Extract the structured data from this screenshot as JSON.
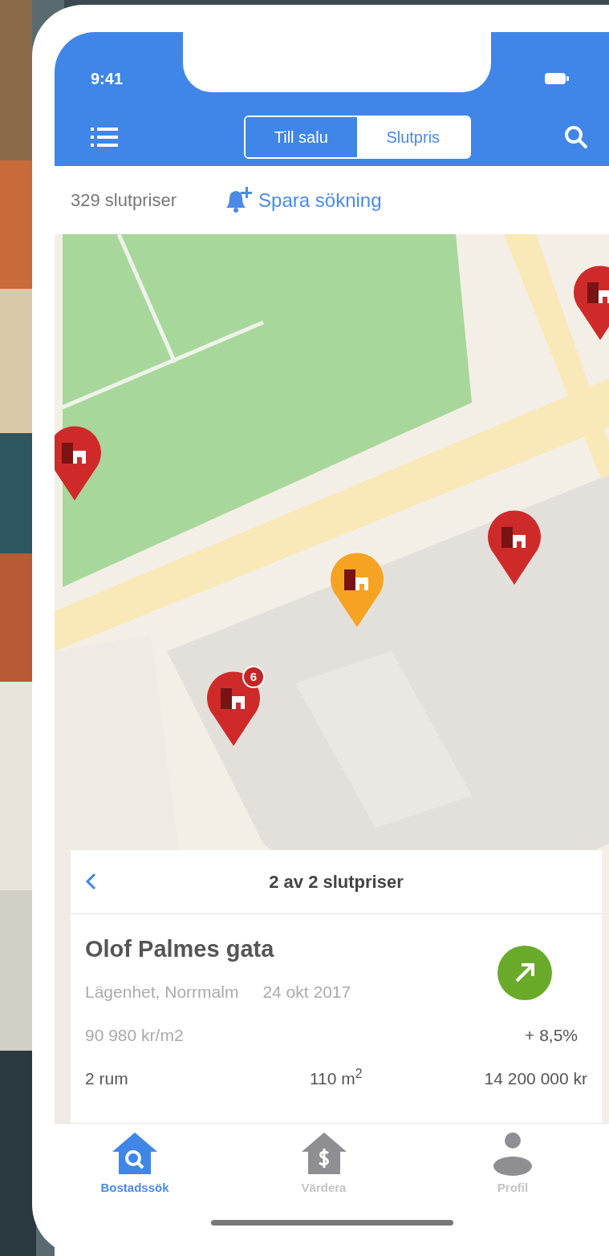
{
  "status_bar": {
    "time": "9:41"
  },
  "toolbar": {
    "segments": [
      {
        "label": "Till salu",
        "selected": false
      },
      {
        "label": "Slutpris",
        "selected": true
      }
    ]
  },
  "summary": {
    "count": "329 slutpriser",
    "save_search": "Spara sökning"
  },
  "map": {
    "kind": "picture",
    "pins": [
      {
        "color": "#cf2a2a"
      },
      {
        "color": "#cf2a2a"
      },
      {
        "color": "#cf2a2a"
      },
      {
        "color": "#f5a321"
      },
      {
        "color": "#cf2a2a",
        "badge": "6"
      }
    ]
  },
  "card": {
    "pager": "2 av 2 slutpriser",
    "title": "Olof Palmes gata",
    "type": "Lägenhet, Norrmalm",
    "date": "24 okt 2017",
    "price_per_m2": "90 980 kr/m2",
    "rising": true,
    "change": "+ 8,5%",
    "rooms": "2 rum",
    "area": "110 m$^{2}$",
    "price": "14 200 000 kr"
  },
  "tab_bar": [
    {
      "label": "Bostadssök",
      "kind": "search",
      "selected": true
    },
    {
      "label": "Värdera",
      "kind": "value",
      "selected": false
    },
    {
      "label": "Profil",
      "kind": "profile",
      "selected": false
    }
  ]
}
